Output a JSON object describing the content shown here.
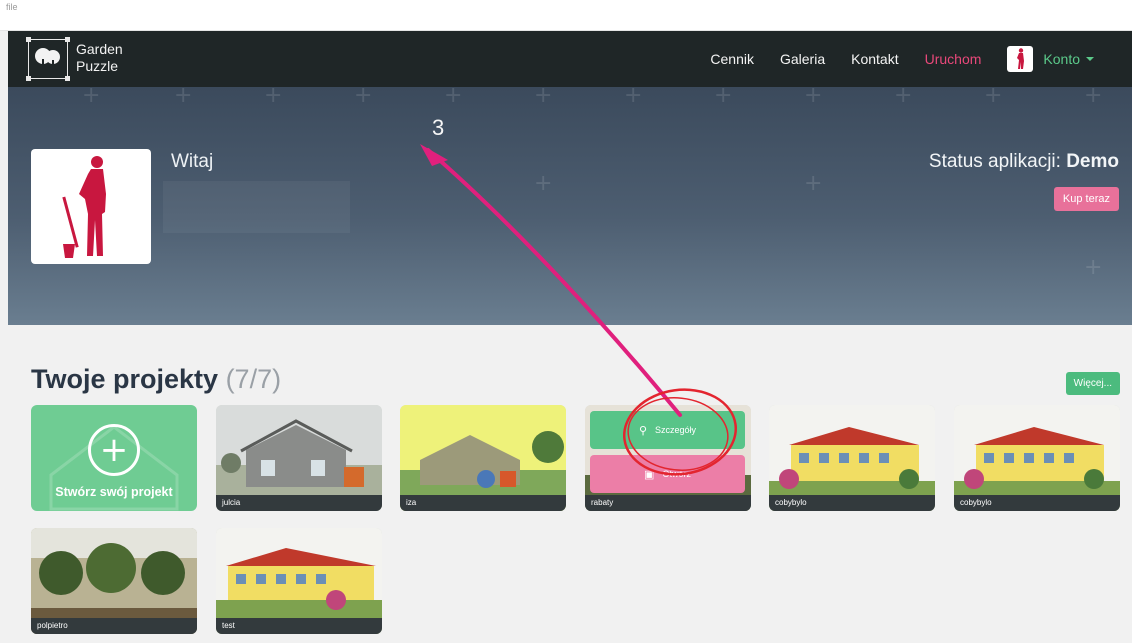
{
  "top_strip": {
    "file_label": "file"
  },
  "brand": {
    "line1": "Garden",
    "line2": "Puzzle"
  },
  "nav": {
    "items": [
      {
        "label": "Cennik"
      },
      {
        "label": "Galeria"
      },
      {
        "label": "Kontakt"
      },
      {
        "label": "Uruchom"
      }
    ],
    "account_label": "Konto"
  },
  "hero": {
    "greeting": "Witaj",
    "status_prefix": "Status aplikacji:",
    "status_value": "Demo",
    "buy_label": "Kup teraz"
  },
  "projects": {
    "title": "Twoje projekty",
    "count": "(7/7)",
    "more_label": "Więcej...",
    "create_label": "Stwórz swój projekt",
    "cards": [
      {
        "name": "julcia"
      },
      {
        "name": "iza"
      },
      {
        "name": "rabaty"
      },
      {
        "name": "cobybylo"
      },
      {
        "name": "cobybylo"
      },
      {
        "name": "polpietro"
      },
      {
        "name": "test"
      }
    ],
    "hover_details_label": "Szczegóły",
    "hover_open_label": "Otwórz"
  },
  "annotation": {
    "number": "3"
  },
  "colors": {
    "navbar": "#1f2627",
    "accent_pink": "#e8487a",
    "accent_green": "#4cbb7e",
    "annotation": "#e0207d"
  }
}
